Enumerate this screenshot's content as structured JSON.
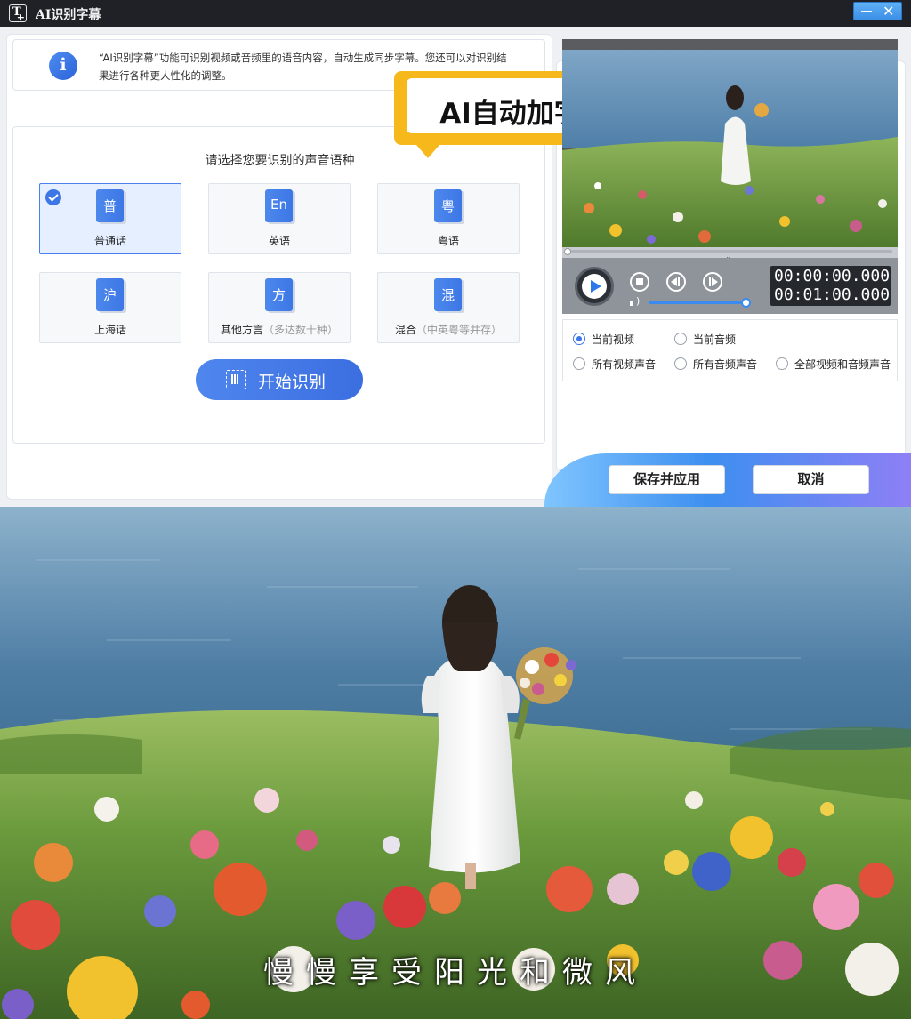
{
  "window": {
    "title": "AI识别字幕"
  },
  "info": {
    "text": "“AI识别字幕”功能可识别视频或音频里的语音内容，自动生成同步字幕。您还可以对识别结果进行各种更人性化的调整。"
  },
  "language": {
    "prompt": "请选择您要识别的声音语种",
    "options": [
      {
        "glyph": "普",
        "label": "普通话",
        "sub": "",
        "selected": true
      },
      {
        "glyph": "En",
        "label": "英语",
        "sub": "",
        "selected": false
      },
      {
        "glyph": "粤",
        "label": "粤语",
        "sub": "",
        "selected": false
      },
      {
        "glyph": "沪",
        "label": "上海话",
        "sub": "",
        "selected": false
      },
      {
        "glyph": "方",
        "label": "其他方言",
        "sub": "（多达数十种）",
        "selected": false
      },
      {
        "glyph": "混",
        "label": "混合",
        "sub": "（中英粤等并存）",
        "selected": false
      }
    ],
    "start_label": "开始识别"
  },
  "banner": {
    "text": "AI自动加字幕"
  },
  "player": {
    "current_time": "00:00:00.000",
    "total_time": "00:01:00.000",
    "progress": 0.0,
    "volume": 0.95
  },
  "scope_options": [
    {
      "label": "当前视频",
      "checked": true
    },
    {
      "label": "当前音频",
      "checked": false
    },
    {
      "label": "所有视频声音",
      "checked": false
    },
    {
      "label": "所有音频声音",
      "checked": false
    },
    {
      "label": "全部视频和音频声音",
      "checked": false
    }
  ],
  "footer": {
    "save_label": "保存并应用",
    "cancel_label": "取消"
  },
  "photo": {
    "subtitle": "慢慢享受阳光和微风"
  },
  "colors": {
    "accent": "#3b77e6",
    "banner": "#f6b81b",
    "titlebar": "#1f2126"
  }
}
